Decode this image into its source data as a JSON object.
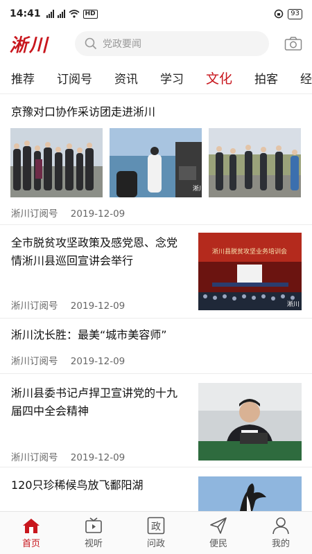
{
  "status": {
    "time": "14:41",
    "network1": "4G",
    "network2": "4G",
    "hd": "HD",
    "battery": "93"
  },
  "header": {
    "logo": "淅川",
    "search_placeholder": "党政要闻"
  },
  "tabs": [
    "推荐",
    "订阅号",
    "资讯",
    "学习",
    "文化",
    "拍客",
    "经济"
  ],
  "active_tab": "文化",
  "news": [
    {
      "title": "京豫对口协作采访团走进淅川",
      "source": "淅川订阅号",
      "date": "2019-12-09",
      "watermark": "淅川"
    },
    {
      "title": "全市脱贫攻坚政策及感党恩、念党情淅川县巡回宣讲会举行",
      "source": "淅川订阅号",
      "date": "2019-12-09",
      "banner": "淅川县脱贫攻坚业务培训会",
      "watermark": "淅川"
    },
    {
      "title": "淅川沈长胜：最美“城市美容师”",
      "source": "淅川订阅号",
      "date": "2019-12-09"
    },
    {
      "title": "淅川县委书记卢捍卫宣讲党的十九届四中全会精神",
      "source": "淅川订阅号",
      "date": "2019-12-09"
    },
    {
      "title": "120只珍稀候鸟放飞鄱阳湖",
      "source": "",
      "date": ""
    }
  ],
  "bottom_nav": [
    {
      "label": "首页",
      "icon": "home-icon",
      "active": true
    },
    {
      "label": "视听",
      "icon": "tv-icon",
      "active": false
    },
    {
      "label": "问政",
      "icon_text": "政",
      "active": false
    },
    {
      "label": "便民",
      "icon": "send-icon",
      "active": false
    },
    {
      "label": "我的",
      "icon": "user-icon",
      "active": false
    }
  ],
  "colors": {
    "brand_red": "#c8161d",
    "text": "#111111",
    "meta": "#666666"
  }
}
